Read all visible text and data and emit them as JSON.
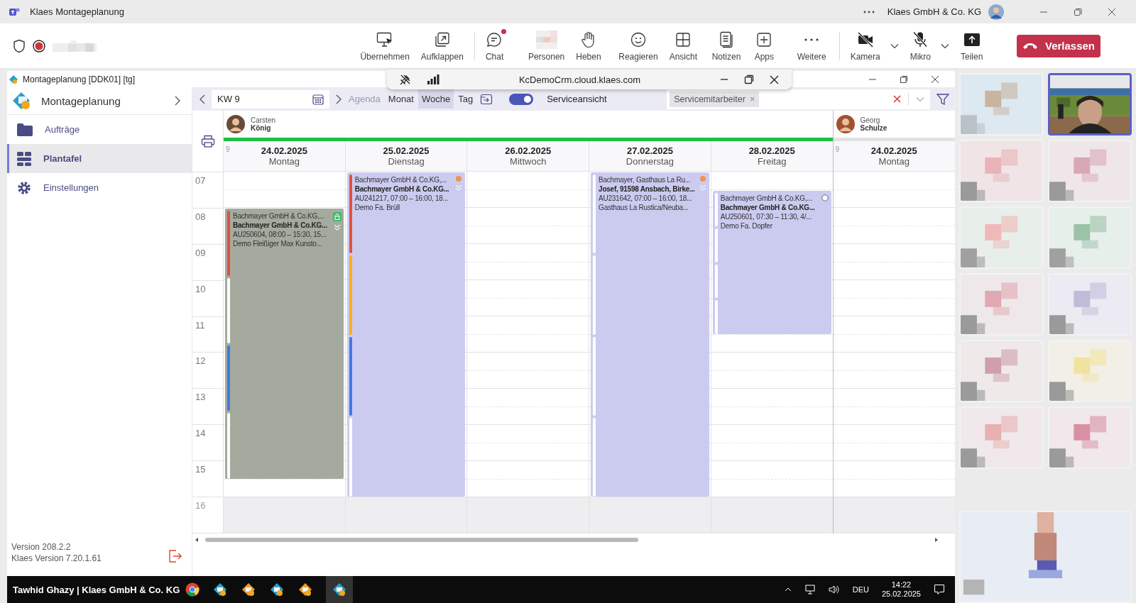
{
  "title_bar": {
    "app_title": "Klaes Montageplanung",
    "account": "Klaes GmbH & Co. KG"
  },
  "meeting_toolbar": {
    "groups": [
      {
        "buttons": [
          {
            "label": "Übernehmen",
            "kind": "takeover",
            "badge": false,
            "dropdown": false
          },
          {
            "label": "Aufklappen",
            "kind": "popout",
            "badge": false,
            "dropdown": false
          }
        ]
      },
      {
        "buttons": [
          {
            "label": "Chat",
            "kind": "chat",
            "badge": true,
            "dropdown": false
          },
          {
            "label": "Personen",
            "kind": "people",
            "badge": false,
            "dropdown": false
          },
          {
            "label": "Heben",
            "kind": "hand",
            "badge": false,
            "dropdown": false
          },
          {
            "label": "Reagieren",
            "kind": "react",
            "badge": false,
            "dropdown": false
          },
          {
            "label": "Ansicht",
            "kind": "view",
            "badge": false,
            "dropdown": false
          },
          {
            "label": "Notizen",
            "kind": "notes",
            "badge": false,
            "dropdown": false
          },
          {
            "label": "Apps",
            "kind": "apps",
            "badge": false,
            "dropdown": false
          },
          {
            "label": "Weitere",
            "kind": "more",
            "badge": false,
            "dropdown": false
          }
        ]
      },
      {
        "buttons": [
          {
            "label": "Kamera",
            "kind": "camera",
            "badge": false,
            "dropdown": true
          },
          {
            "label": "Mikro",
            "kind": "mic",
            "badge": false,
            "dropdown": true
          },
          {
            "label": "Teilen",
            "kind": "share",
            "badge": false,
            "dropdown": false
          }
        ]
      }
    ],
    "leave": "Verlassen"
  },
  "share_bar": {
    "url": "KcDemoCrm.cloud.klaes.com"
  },
  "app": {
    "title": "Montageplanung [DDK01] [tg]",
    "sidebar": {
      "title": "Montageplanung",
      "items": [
        {
          "label": "Aufträge",
          "kind": "folder",
          "selected": false
        },
        {
          "label": "Plantafel",
          "kind": "board",
          "selected": true
        },
        {
          "label": "Einstellungen",
          "kind": "gear",
          "selected": false
        }
      ],
      "version": "Version 208.2.2",
      "klaes_version": "Klaes Version 7.20.1.61"
    },
    "calendar": {
      "week": "KW 9",
      "views": [
        {
          "label": "Agenda",
          "disabled": true,
          "selected": false
        },
        {
          "label": "Monat",
          "disabled": false,
          "selected": false
        },
        {
          "label": "Woche",
          "disabled": false,
          "selected": true
        },
        {
          "label": "Tag",
          "disabled": false,
          "selected": false
        }
      ],
      "service_view": {
        "label": "Serviceansicht",
        "on": true
      },
      "filter_chips": [
        {
          "label": "Servicemitarbeiter",
          "remove": "×"
        }
      ],
      "hours": [
        {
          "label": "07",
          "off": false
        },
        {
          "label": "08",
          "off": false
        },
        {
          "label": "09",
          "off": false
        },
        {
          "label": "10",
          "off": false
        },
        {
          "label": "11",
          "off": false
        },
        {
          "label": "12",
          "off": false
        },
        {
          "label": "13",
          "off": false
        },
        {
          "label": "14",
          "off": false
        },
        {
          "label": "15",
          "off": false
        },
        {
          "label": "16",
          "off": true
        }
      ],
      "resources": [
        {
          "first_name": "Carsten",
          "last_name": "König",
          "color": "#1fbf45",
          "days": [
            {
              "week": "9",
              "date": "24.02.2025",
              "weekday": "Montag",
              "events": [
                {
                  "color": "#a5aa9e",
                  "kind": "locked",
                  "expandable": true,
                  "stripes": [
                    {
                      "color": "#e0523f"
                    },
                    {
                      "color": "#ffffff"
                    },
                    {
                      "color": "#3f7be0"
                    },
                    {
                      "color": "#ffffff"
                    }
                  ],
                  "lines": [
                    "Bachmayer GmbH & Co.KG,...",
                    "Bachmayer GmbH & Co.KG...",
                    "AU250604, 08:00 – 15:30, 15...",
                    "Demo Fleißiger Max Kunsto..."
                  ]
                }
              ]
            },
            {
              "date": "25.02.2025",
              "weekday": "Dienstag",
              "events": [
                {
                  "color": "#cbcbf0",
                  "kind": "pending",
                  "expandable": true,
                  "stripes": [
                    {
                      "color": "#e0523f"
                    },
                    {
                      "color": "#f5b21b"
                    },
                    {
                      "color": "#3f7be0"
                    },
                    {
                      "color": "#ffffff"
                    }
                  ],
                  "lines": [
                    "Bachmayer GmbH & Co.KG,...",
                    "Bachmayer GmbH & Co.KG...",
                    "AU241217, 07:00 – 16:00, 18...",
                    "Demo Fa. Brüll"
                  ]
                }
              ]
            },
            {
              "date": "26.02.2025",
              "weekday": "Mittwoch"
            },
            {
              "date": "27.02.2025",
              "weekday": "Donnerstag",
              "events": [
                {
                  "color": "#cbcbf0",
                  "kind": "pending",
                  "expandable": true,
                  "stripes": [
                    {
                      "color": "#ffffff"
                    },
                    {
                      "color": "#ffffff"
                    },
                    {
                      "color": "#ffffff"
                    },
                    {
                      "color": "#ffffff"
                    }
                  ],
                  "lines": [
                    "Bachmayer, Gasthaus La Ru...",
                    "Josef, 91598 Ansbach, Birke...",
                    "AU231642, 07:00 – 16:00, 18...",
                    "Gasthaus La Rustica/Neuba..."
                  ]
                }
              ]
            },
            {
              "date": "28.02.2025",
              "weekday": "Freitag",
              "events": [
                {
                  "color": "#cbcbf0",
                  "kind": "open",
                  "expandable": false,
                  "stripes": [
                    {
                      "color": "#ffffff"
                    },
                    {
                      "color": "#ffffff"
                    },
                    {
                      "color": "#ffffff"
                    },
                    {
                      "color": "#ffffff"
                    }
                  ],
                  "lines": [
                    "Bachmayer GmbH & Co.KG,...",
                    "Bachmayer GmbH & Co.KG...",
                    "AU250601, 07:30 – 11:30, 4/...",
                    "Demo Fa. Dopfer"
                  ]
                }
              ]
            }
          ]
        },
        {
          "first_name": "Georg",
          "last_name": "Schulze",
          "color": "#e2e2e6",
          "days": [
            {
              "week": "9",
              "date": "24.02.2025",
              "weekday": "Montag"
            }
          ]
        }
      ]
    }
  },
  "taskbar": {
    "user": "Tawhid Ghazy | Klaes GmbH & Co. KG",
    "language": "DEU",
    "time": "14:22",
    "date": "25.02.2025"
  },
  "participants": [
    {
      "kind": "picture",
      "selected": false
    },
    {
      "kind": "picture",
      "selected": true
    },
    {
      "kind": "picture",
      "selected": false
    },
    {
      "kind": "picture",
      "selected": false
    },
    {
      "kind": "picture",
      "selected": false
    },
    {
      "kind": "picture",
      "selected": false
    },
    {
      "kind": "picture",
      "selected": false
    },
    {
      "kind": "picture",
      "selected": false
    },
    {
      "kind": "picture",
      "selected": false
    },
    {
      "kind": "picture",
      "selected": false
    },
    {
      "kind": "picture",
      "selected": false
    },
    {
      "kind": "picture",
      "selected": false
    },
    {
      "kind": "picture",
      "selected": false
    }
  ]
}
